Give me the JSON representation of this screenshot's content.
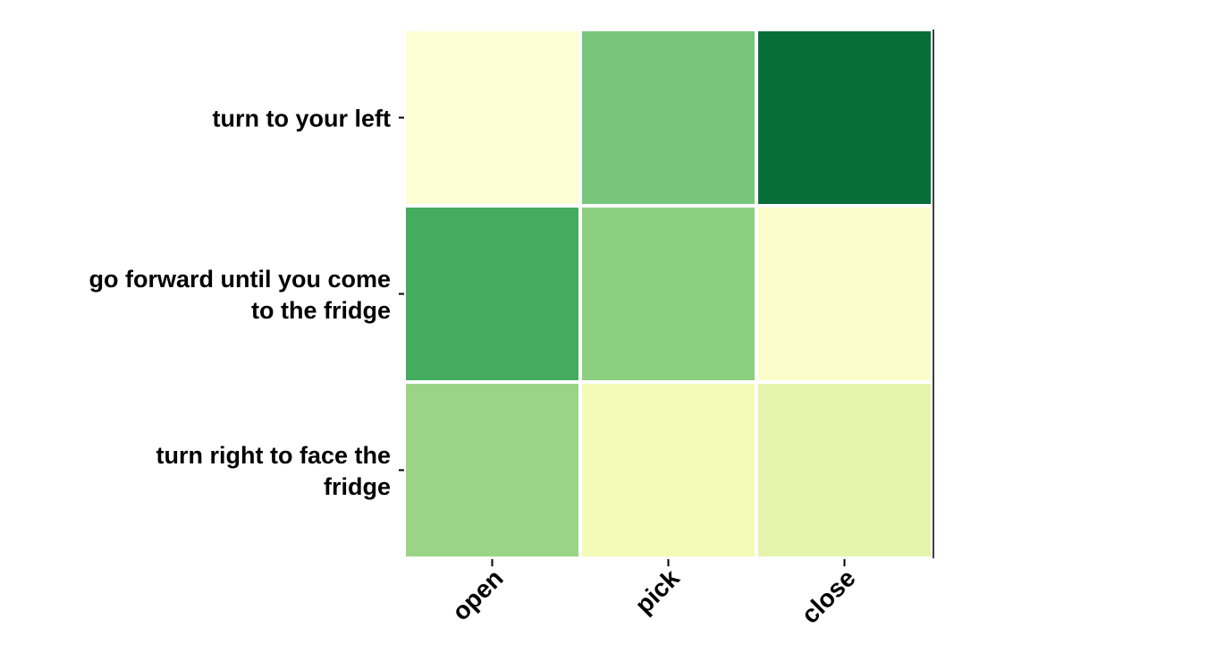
{
  "chart_data": {
    "type": "heatmap",
    "title": "",
    "xlabel": "",
    "ylabel": "",
    "x_categories": [
      "open",
      "pick",
      "close"
    ],
    "y_categories": [
      [
        "turn to your left"
      ],
      [
        "go forward until you come",
        "to the fridge"
      ],
      [
        "turn right to face the",
        "fridge"
      ]
    ],
    "values": [
      [
        0.05,
        0.5,
        0.85
      ],
      [
        0.62,
        0.45,
        0.08
      ],
      [
        0.42,
        0.14,
        0.2
      ]
    ],
    "value_range": [
      0,
      1
    ],
    "colormap": "YlGn",
    "colorbar": false,
    "cell_labels": false
  }
}
